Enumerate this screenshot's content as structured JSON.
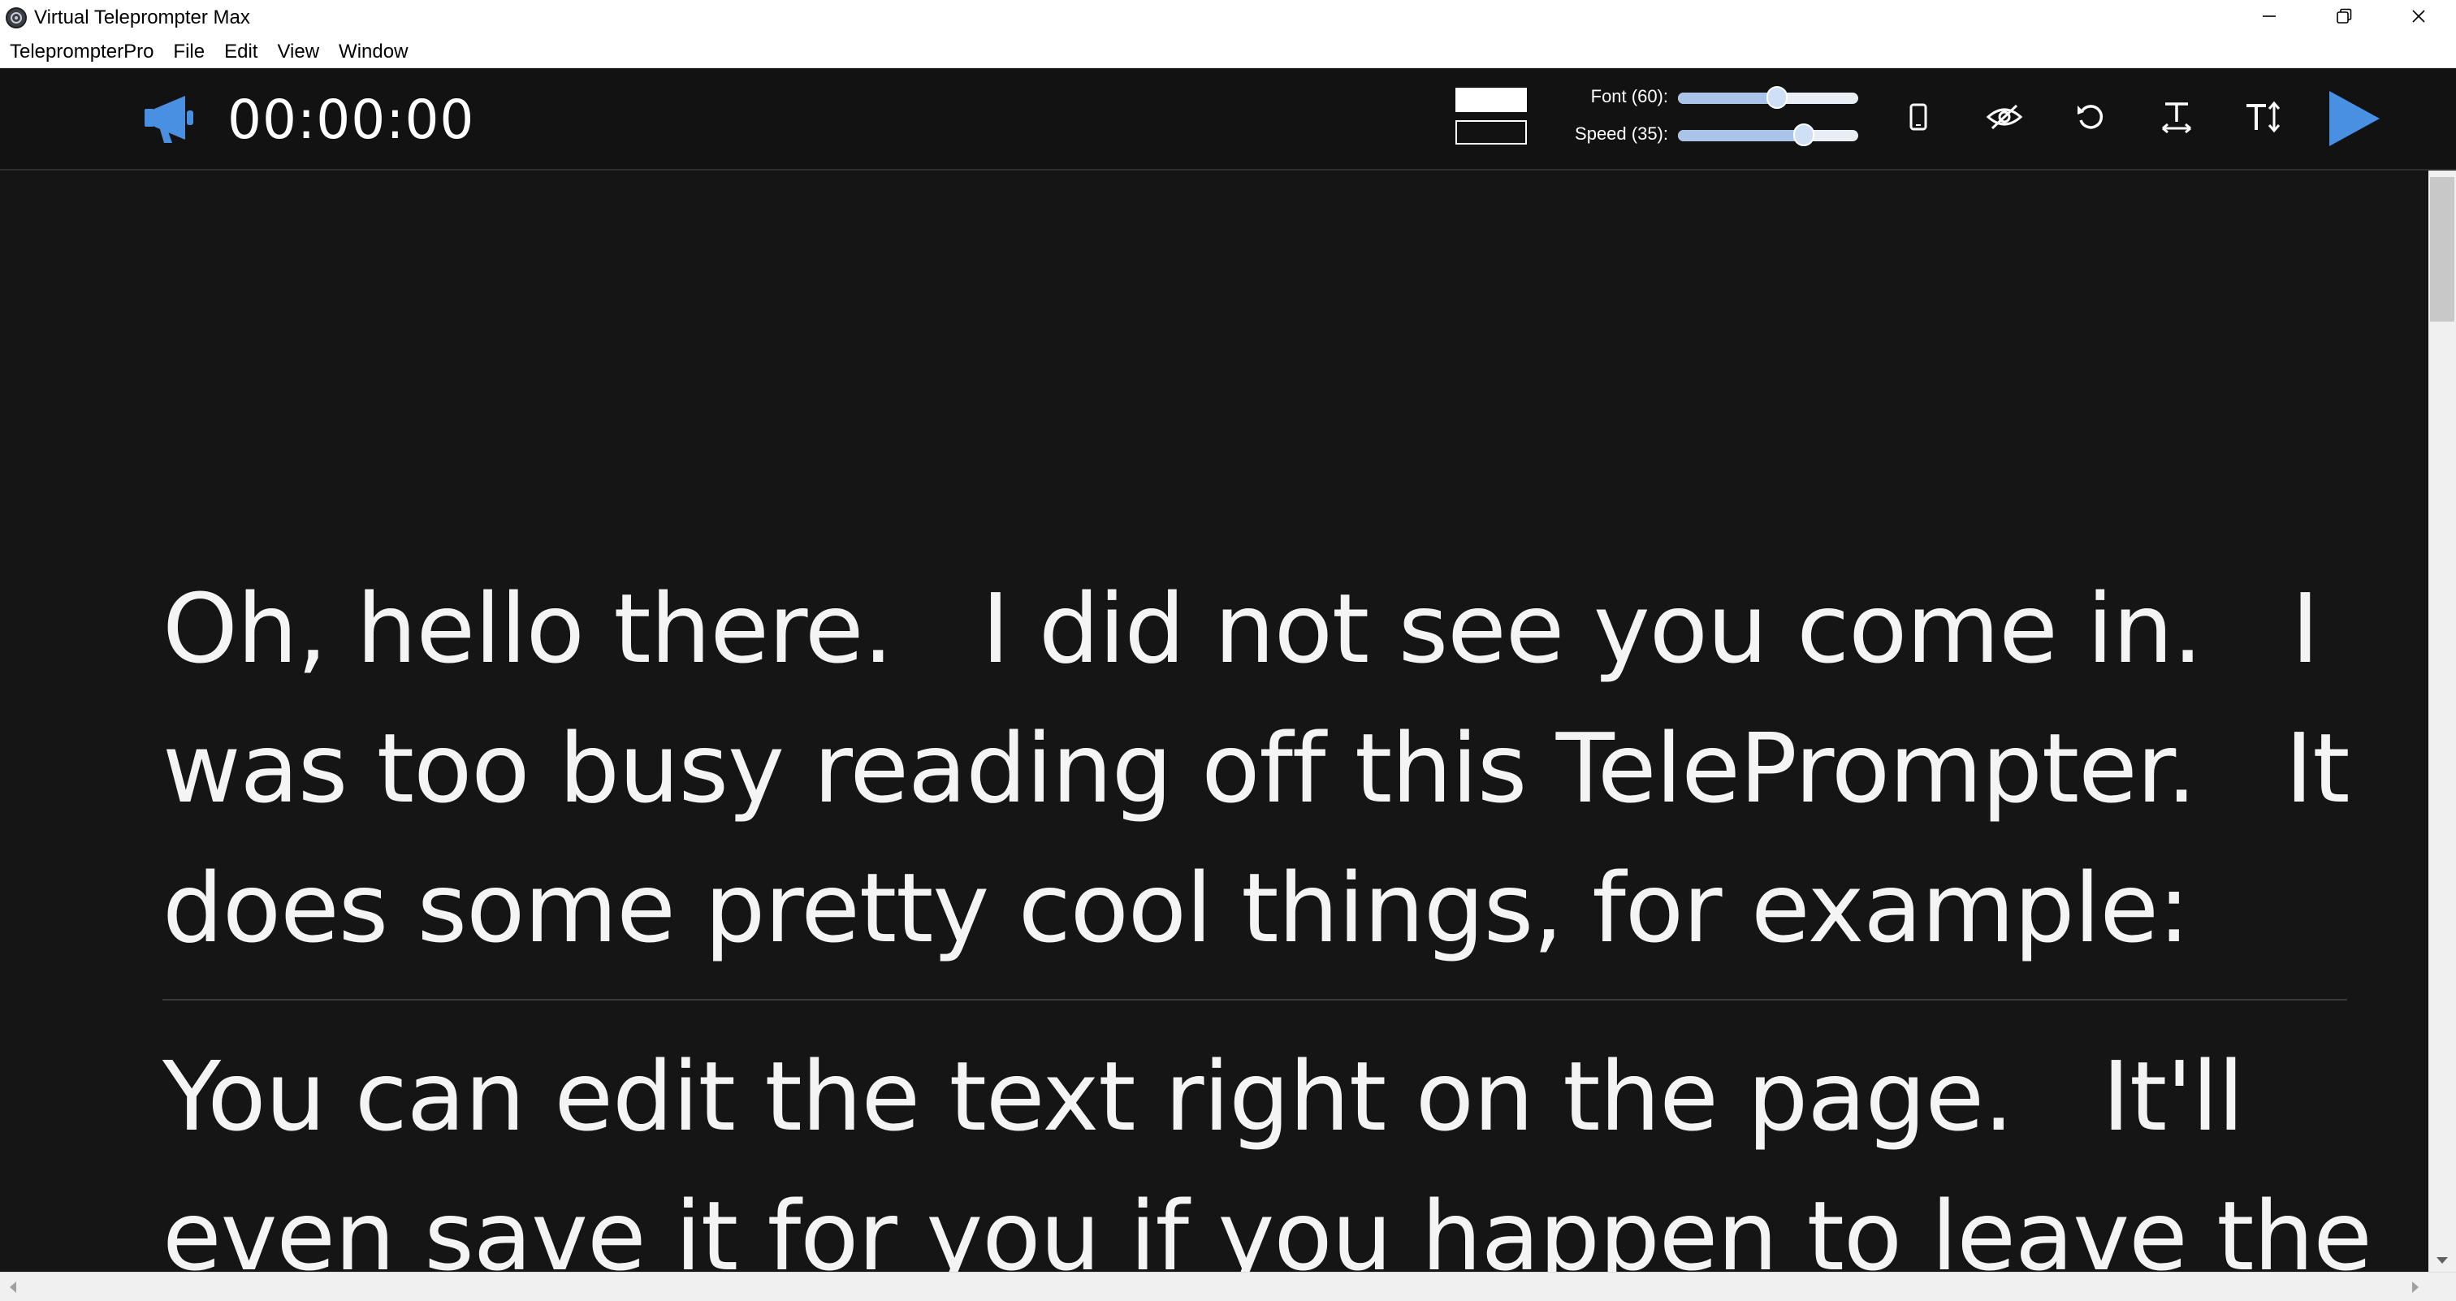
{
  "window": {
    "title": "Virtual Teleprompter Max",
    "icon": "teleprompter-app-icon",
    "controls": [
      "minimize-icon",
      "restore-icon",
      "close-icon"
    ]
  },
  "menu": {
    "items": [
      {
        "label": "TeleprompterPro"
      },
      {
        "label": "File"
      },
      {
        "label": "Edit"
      },
      {
        "label": "View"
      },
      {
        "label": "Window"
      }
    ]
  },
  "toolbar": {
    "timer": "00:00:00",
    "megaphone_icon": "megaphone-icon",
    "text_color": "#ffffff",
    "background_color": "#121212",
    "font": {
      "label": "Font (60):",
      "value": 60,
      "fraction": 0.55
    },
    "speed": {
      "label": "Speed (35):",
      "value": 35,
      "fraction": 0.7
    },
    "buttons": [
      {
        "name": "mirror-device-icon"
      },
      {
        "name": "eye-slash-icon"
      },
      {
        "name": "reset-icon"
      },
      {
        "name": "text-width-icon"
      },
      {
        "name": "text-size-icon"
      },
      {
        "name": "play-icon"
      }
    ],
    "accent_color": "#4a90e2"
  },
  "script": {
    "paragraphs": [
      "Oh, hello there.   I did not see you come in.   I was too busy reading off this TelePrompter.   It does some pretty cool things, for example:",
      "You can edit the text right on the page.   It'll even save it for you if you happen to leave the"
    ],
    "text_color": "#f4f4f4",
    "background": "#151515"
  }
}
